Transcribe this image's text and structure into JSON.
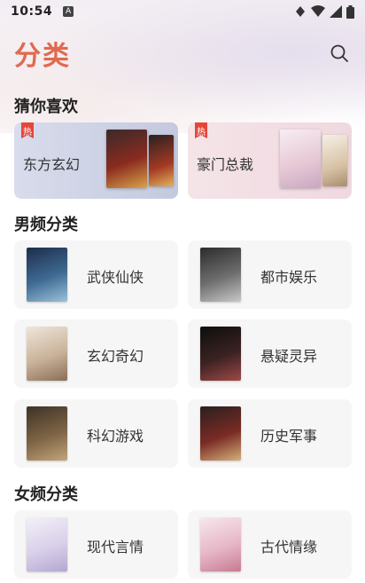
{
  "status_bar": {
    "time": "10:54",
    "notif_icon": "A"
  },
  "header": {
    "title": "分类"
  },
  "guess": {
    "title": "猜你喜欢",
    "hot_badge": "热",
    "cards": [
      {
        "label": "东方玄幻"
      },
      {
        "label": "豪门总裁"
      }
    ]
  },
  "male": {
    "title": "男频分类",
    "items": [
      {
        "label": "武侠仙侠"
      },
      {
        "label": "都市娱乐"
      },
      {
        "label": "玄幻奇幻"
      },
      {
        "label": "悬疑灵异"
      },
      {
        "label": "科幻游戏"
      },
      {
        "label": "历史军事"
      }
    ]
  },
  "female": {
    "title": "女频分类",
    "items": [
      {
        "label": "现代言情"
      },
      {
        "label": "古代情缘"
      }
    ]
  },
  "colors": {
    "accent": "#e06a4f",
    "card_bg": "#f6f6f6",
    "hot": "#e4473a"
  }
}
